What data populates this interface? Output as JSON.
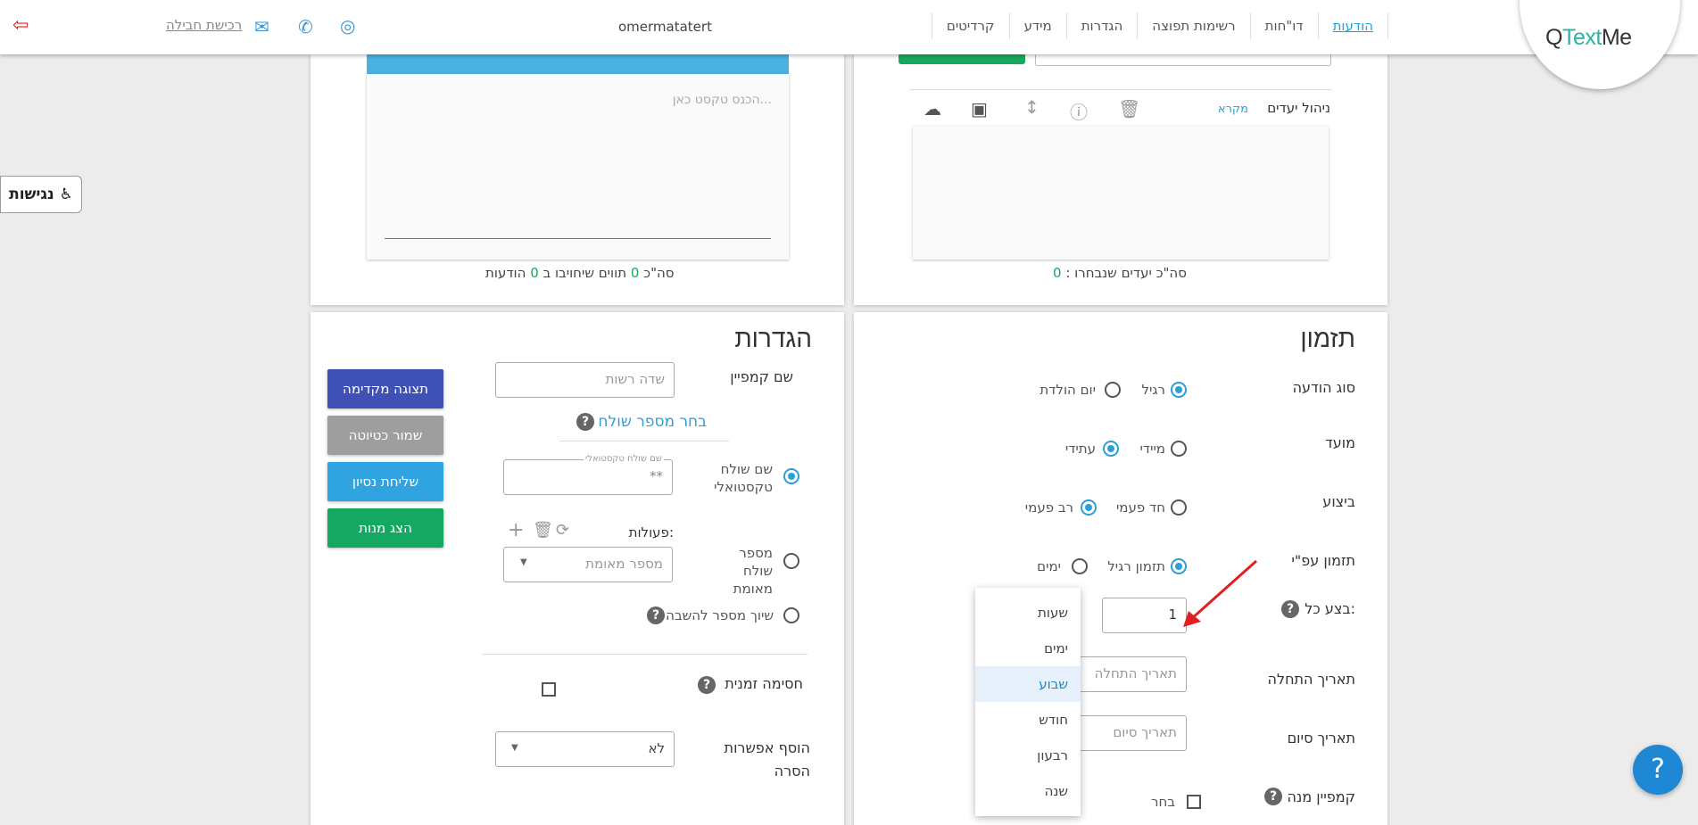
{
  "app": {
    "logo_q": "Q",
    "logo_text": "Text",
    "logo_me": "Me",
    "username": "omermatatert",
    "buy_link": "רכישת חבילה"
  },
  "nav": [
    "הודעות",
    "דו\"חות",
    "רשימות תפוצה",
    "הגדרות",
    "מידע",
    "קרדיטים"
  ],
  "recipients": {
    "label": "ניהול יעדים",
    "legend_link": "מקרא",
    "total_label": "סה\"כ יעדים שנבחרו :",
    "total_value": "0"
  },
  "editor": {
    "placeholder": "הכנס טקסט כאן...",
    "total_prefix": "סה\"כ",
    "total_value": "0",
    "total_mid": "תווים שיחויבו ב",
    "total_msgs": "0",
    "total_suffix": "הודעות"
  },
  "scheduling": {
    "title": "תזמון",
    "msg_type_label": "סוג הודעה",
    "msg_type_regular": "רגיל",
    "msg_type_birthday": "יום הולדת",
    "timing_label": "מועד",
    "timing_now": "מיידי",
    "timing_future": "עתידי",
    "exec_label": "ביצוע",
    "exec_once": "חד פעמי",
    "exec_multi": "רב פעמי",
    "schedule_by_label": "תזמון עפ\"י",
    "schedule_regular": "תזמון רגיל",
    "schedule_days": "ימים",
    "every_label": "בצע כל:",
    "every_value": "1",
    "start_label": "תאריך התחלה",
    "start_placeholder": "תאריך התחלה",
    "end_label": "תאריך סיום",
    "end_placeholder": "תאריך סיום",
    "subscription_label": "קמפיין מנה",
    "subscription_choose": "בחר"
  },
  "period_options": [
    "שעות",
    "ימים",
    "שבוע",
    "חודש",
    "רבעון",
    "שנה"
  ],
  "period_selected": "שבוע",
  "settings": {
    "title": "הגדרות",
    "campaign_name_label": "שם קמפיין",
    "campaign_name_placeholder": "שדה רשות",
    "choose_sender": "בחר מספר שולח",
    "text_sender_label": "שם שולח טקסטואלי",
    "text_sender_floating": "שם שולח טקסטואלי",
    "text_sender_value": "**",
    "actions_label": "פעולות:",
    "verified_sender_label": "מספר שולח מאומת",
    "verified_sender_placeholder": "מספר מאומת",
    "reply_number_label": "שיוך מספר להשבה",
    "temp_block_label": "חסימה זמנית",
    "unsubscribe_label": "הוסף אפשרות הסרה",
    "unsubscribe_value": "לא"
  },
  "buttons": {
    "preview": "תצוגה מקדימה",
    "save_draft": "שמור כטיוטה",
    "test_send": "שליחת נסיון",
    "show_subs": "הצג מנות"
  },
  "colors": {
    "preview": "#3f51b5",
    "save_draft": "#9e9e9e",
    "test_send": "#2fa4e0",
    "show_subs": "#15a862",
    "accent": "#2a9fd8"
  },
  "accessibility": "נגישות"
}
